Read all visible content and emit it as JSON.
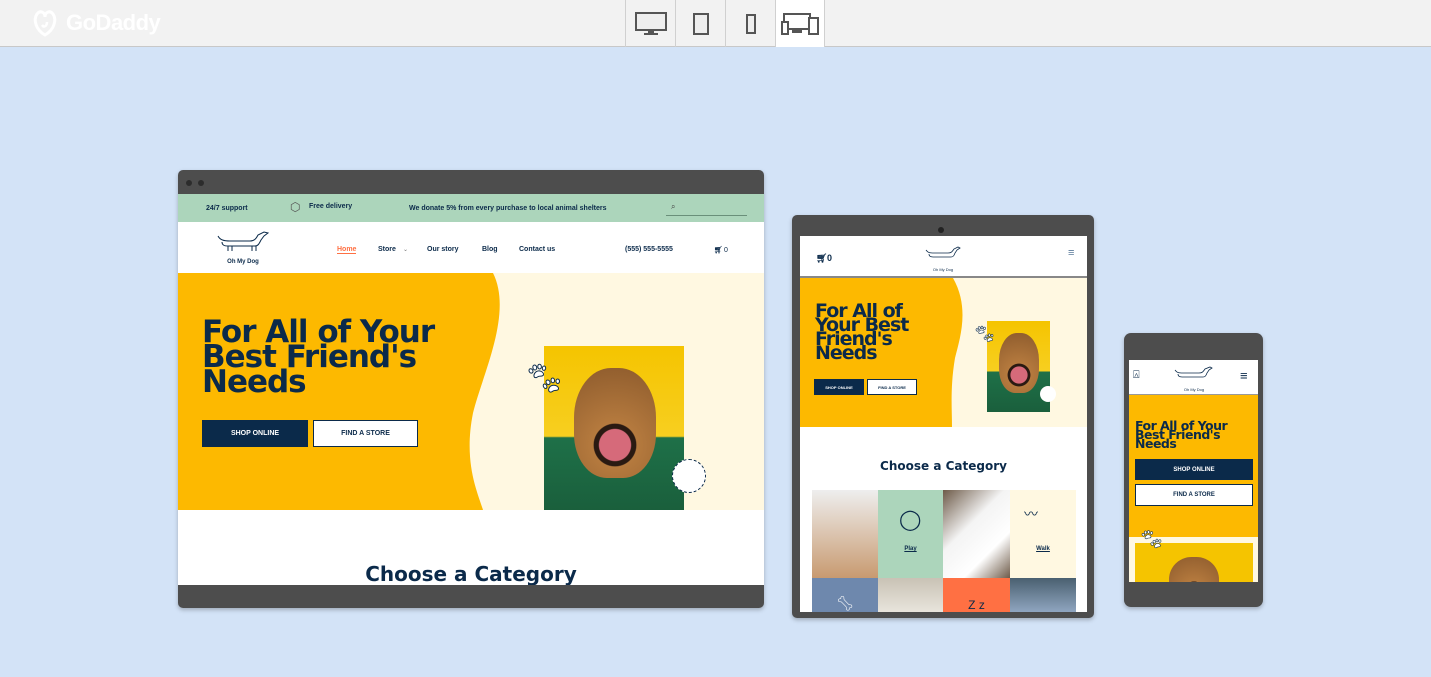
{
  "app": {
    "brand": "GoDaddy",
    "device_modes": [
      {
        "name": "desktop",
        "icon": "desktop-icon",
        "active": false
      },
      {
        "name": "tablet",
        "icon": "tablet-icon",
        "active": false
      },
      {
        "name": "mobile",
        "icon": "phone-icon",
        "active": false
      },
      {
        "name": "all-devices",
        "icon": "multi-device-icon",
        "active": true
      }
    ]
  },
  "colors": {
    "background": "#d3e3f7",
    "hero_yellow": "#fdb900",
    "navy": "#0b2a4a",
    "mint": "#acd5bb",
    "cream": "#fff8e1",
    "accent": "#ff7043"
  },
  "site": {
    "banner": {
      "support": "24/7 support",
      "delivery": "Free delivery",
      "donate": "We donate 5% from every purchase to local animal shelters"
    },
    "logo_text": "Oh My Dog",
    "nav": [
      {
        "label": "Home",
        "active": true
      },
      {
        "label": "Store"
      },
      {
        "label": "Our story"
      },
      {
        "label": "Blog"
      },
      {
        "label": "Contact us"
      }
    ],
    "phone": "(555) 555-5555",
    "cart_count": "0",
    "hero": {
      "title": "For All of Your Best Friend's Needs",
      "shop_button": "SHOP ONLINE",
      "store_button": "FIND A STORE",
      "badge": "OH MY DOG"
    },
    "category_heading": "Choose a Category",
    "categories": [
      {
        "label": ""
      },
      {
        "label": "Play"
      },
      {
        "label": ""
      },
      {
        "label": "Walk"
      },
      {
        "label": ""
      },
      {
        "label": ""
      },
      {
        "label": ""
      },
      {
        "label": ""
      }
    ]
  }
}
